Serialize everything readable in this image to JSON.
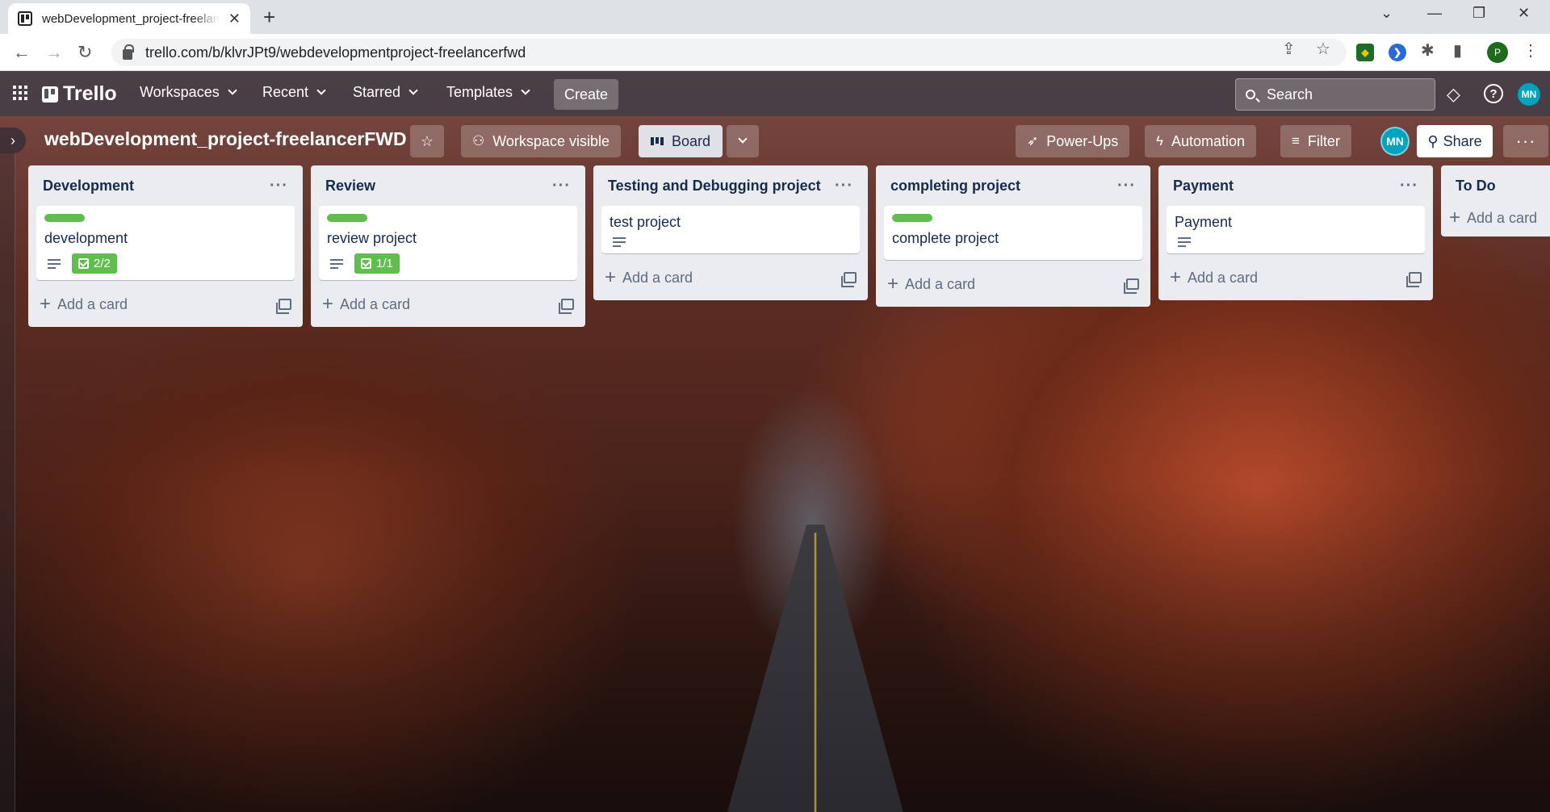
{
  "browser": {
    "tab_title": "webDevelopment_project-freelancerFWD",
    "url": "trello.com/b/klvrJPt9/webdevelopmentproject-freelancerfwd",
    "profile_initial": "P"
  },
  "app": {
    "brand": "Trello",
    "menus": [
      "Workspaces",
      "Recent",
      "Starred",
      "Templates"
    ],
    "create_label": "Create",
    "search_placeholder": "Search",
    "user_initials": "MN"
  },
  "board": {
    "title": "webDevelopment_project-freelancerFWD",
    "visibility_label": "Workspace visible",
    "view_label": "Board",
    "powerups_label": "Power-Ups",
    "automation_label": "Automation",
    "filter_label": "Filter",
    "share_label": "Share",
    "member_initials": "MN"
  },
  "lists": [
    {
      "title": "Development",
      "card": {
        "title": "development",
        "label_color": "#61bd4f",
        "has_description": true,
        "checklist": "2/2"
      },
      "add_label": "Add a card"
    },
    {
      "title": "Review",
      "card": {
        "title": "review project",
        "label_color": "#61bd4f",
        "has_description": true,
        "checklist": "1/1"
      },
      "add_label": "Add a card"
    },
    {
      "title": "Testing and Debugging project",
      "card": {
        "title": "test project",
        "has_description": true
      },
      "add_label": "Add a card"
    },
    {
      "title": "completing project",
      "card": {
        "title": "complete project",
        "label_color": "#61bd4f"
      },
      "add_label": "Add a card"
    },
    {
      "title": "Payment",
      "card": {
        "title": "Payment",
        "has_description": true
      },
      "add_label": "Add a card"
    },
    {
      "title": "To Do",
      "add_label": "Add a card"
    }
  ],
  "colors": {
    "accent_green": "#61bd4f",
    "avatar_teal": "#00a3bf",
    "list_bg": "#ebecf0"
  }
}
